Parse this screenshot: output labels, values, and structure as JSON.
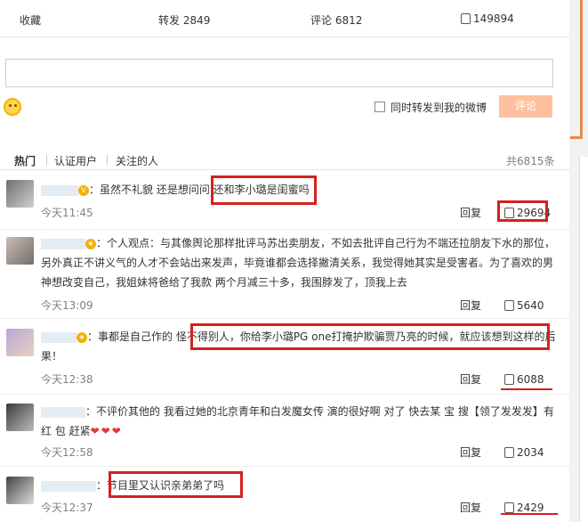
{
  "stats": {
    "favorite": "收藏",
    "repost": "转发 2849",
    "comment": "评论 6812",
    "like": "149894"
  },
  "composer": {
    "forward_label": "同时转发到我的微博",
    "comment_button": "评论"
  },
  "tabs": {
    "items": [
      "热门",
      "认证用户",
      "关注的人"
    ],
    "total": "共6815条"
  },
  "comments": [
    {
      "text": "：虽然不礼貌 还是想问问 还和李小璐是闺蜜吗",
      "time": "今天11:45",
      "reply": "回复",
      "likes": "29694"
    },
    {
      "text": "：个人观点：与其像舆论那样批评马苏出卖朋友，不如去批评自己行为不端还拉朋友下水的那位，另外真正不讲义气的人才不会站出来发声，毕竟谁都会选择撇清关系，我觉得她其实是受害者。为了喜欢的男神想改变自己，我姐妹将爸给了我款 两个月减三十多，我围脖发了，顶我上去",
      "time": "今天13:09",
      "reply": "回复",
      "likes": "5640"
    },
    {
      "text": "：事都是自己作的 怪不得别人，你给李小璐PG one打掩护欺骗贾乃亮的时候，就应该想到这样的后果！",
      "time": "今天12:38",
      "reply": "回复",
      "likes": "6088"
    },
    {
      "text": "：不评价其他的 我看过她的北京青年和白发魔女传 演的很好啊 对了 快去某 宝 搜【领了发发发】有红 包 赶紧",
      "hearts": "❤❤❤",
      "time": "今天12:58",
      "reply": "回复",
      "likes": "2034"
    },
    {
      "text": "：节目里又认识亲弟弟了吗",
      "time": "今天12:37",
      "reply": "回复",
      "likes": "2429"
    }
  ],
  "colors": {
    "highlight": "#d62020",
    "accent_orange": "#e98a4a",
    "comment_button_bg": "#ffc09f"
  }
}
